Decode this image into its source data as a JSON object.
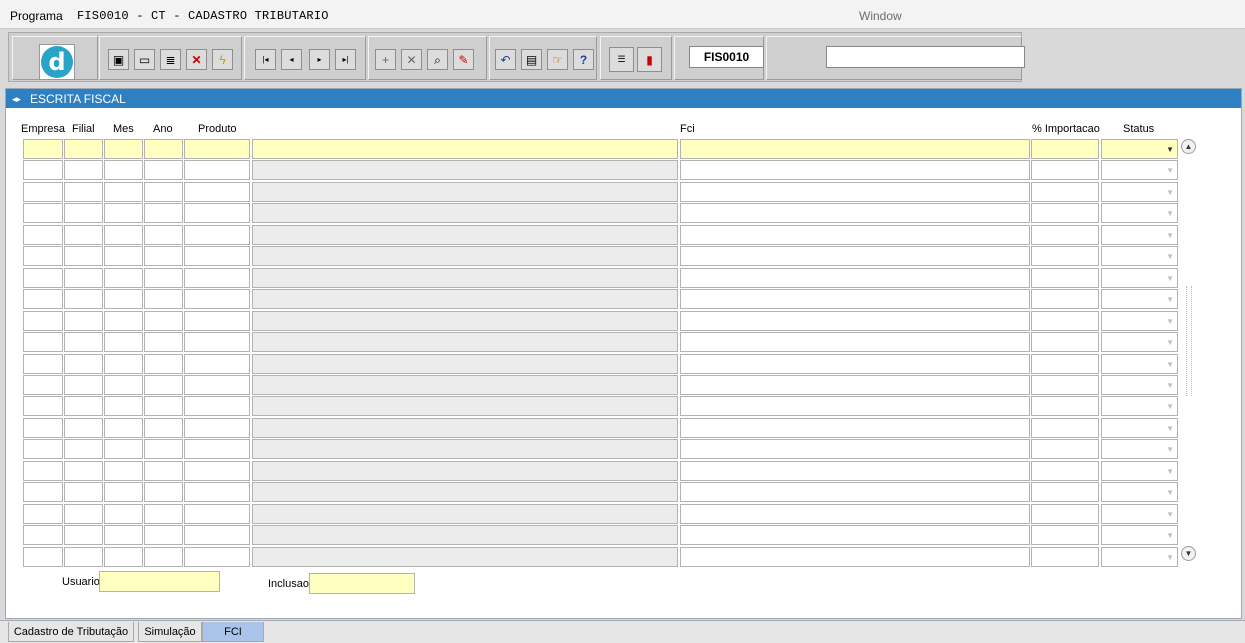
{
  "menubar": {
    "programa": "Programa",
    "title": "FIS0010 - CT - CADASTRO TRIBUTARIO",
    "window": "Window"
  },
  "toolbar": {
    "logo_letter": "d",
    "program_code": "FIS0010",
    "search_value": ""
  },
  "panel": {
    "title": "ESCRITA FISCAL"
  },
  "columns": {
    "empresa": "Empresa",
    "filial": "Filial",
    "mes": "Mes",
    "ano": "Ano",
    "produto": "Produto",
    "fci": "Fci",
    "importacao": "% Importacao",
    "status": "Status"
  },
  "rows": [
    {
      "empresa": "",
      "filial": "",
      "mes": "",
      "ano": "",
      "produto": "",
      "descricao": "",
      "fci": "",
      "importacao": "",
      "status": ""
    },
    {
      "empresa": "",
      "filial": "",
      "mes": "",
      "ano": "",
      "produto": "",
      "descricao": "",
      "fci": "",
      "importacao": "",
      "status": ""
    },
    {
      "empresa": "",
      "filial": "",
      "mes": "",
      "ano": "",
      "produto": "",
      "descricao": "",
      "fci": "",
      "importacao": "",
      "status": ""
    },
    {
      "empresa": "",
      "filial": "",
      "mes": "",
      "ano": "",
      "produto": "",
      "descricao": "",
      "fci": "",
      "importacao": "",
      "status": ""
    },
    {
      "empresa": "",
      "filial": "",
      "mes": "",
      "ano": "",
      "produto": "",
      "descricao": "",
      "fci": "",
      "importacao": "",
      "status": ""
    },
    {
      "empresa": "",
      "filial": "",
      "mes": "",
      "ano": "",
      "produto": "",
      "descricao": "",
      "fci": "",
      "importacao": "",
      "status": ""
    },
    {
      "empresa": "",
      "filial": "",
      "mes": "",
      "ano": "",
      "produto": "",
      "descricao": "",
      "fci": "",
      "importacao": "",
      "status": ""
    },
    {
      "empresa": "",
      "filial": "",
      "mes": "",
      "ano": "",
      "produto": "",
      "descricao": "",
      "fci": "",
      "importacao": "",
      "status": ""
    },
    {
      "empresa": "",
      "filial": "",
      "mes": "",
      "ano": "",
      "produto": "",
      "descricao": "",
      "fci": "",
      "importacao": "",
      "status": ""
    },
    {
      "empresa": "",
      "filial": "",
      "mes": "",
      "ano": "",
      "produto": "",
      "descricao": "",
      "fci": "",
      "importacao": "",
      "status": ""
    },
    {
      "empresa": "",
      "filial": "",
      "mes": "",
      "ano": "",
      "produto": "",
      "descricao": "",
      "fci": "",
      "importacao": "",
      "status": ""
    },
    {
      "empresa": "",
      "filial": "",
      "mes": "",
      "ano": "",
      "produto": "",
      "descricao": "",
      "fci": "",
      "importacao": "",
      "status": ""
    },
    {
      "empresa": "",
      "filial": "",
      "mes": "",
      "ano": "",
      "produto": "",
      "descricao": "",
      "fci": "",
      "importacao": "",
      "status": ""
    },
    {
      "empresa": "",
      "filial": "",
      "mes": "",
      "ano": "",
      "produto": "",
      "descricao": "",
      "fci": "",
      "importacao": "",
      "status": ""
    },
    {
      "empresa": "",
      "filial": "",
      "mes": "",
      "ano": "",
      "produto": "",
      "descricao": "",
      "fci": "",
      "importacao": "",
      "status": ""
    },
    {
      "empresa": "",
      "filial": "",
      "mes": "",
      "ano": "",
      "produto": "",
      "descricao": "",
      "fci": "",
      "importacao": "",
      "status": ""
    },
    {
      "empresa": "",
      "filial": "",
      "mes": "",
      "ano": "",
      "produto": "",
      "descricao": "",
      "fci": "",
      "importacao": "",
      "status": ""
    },
    {
      "empresa": "",
      "filial": "",
      "mes": "",
      "ano": "",
      "produto": "",
      "descricao": "",
      "fci": "",
      "importacao": "",
      "status": ""
    },
    {
      "empresa": "",
      "filial": "",
      "mes": "",
      "ano": "",
      "produto": "",
      "descricao": "",
      "fci": "",
      "importacao": "",
      "status": ""
    },
    {
      "empresa": "",
      "filial": "",
      "mes": "",
      "ano": "",
      "produto": "",
      "descricao": "",
      "fci": "",
      "importacao": "",
      "status": ""
    }
  ],
  "footer": {
    "usuario_label": "Usuario",
    "usuario_value": "",
    "inclusao_label": "Inclusao",
    "inclusao_value": ""
  },
  "tabs": [
    {
      "label": "Cadastro de Tributação",
      "active": false
    },
    {
      "label": "Simulação",
      "active": false
    },
    {
      "label": "FCI",
      "active": true
    }
  ],
  "colors": {
    "header_blue": "#2e80c2",
    "required_yellow": "#ffffc0",
    "active_tab": "#a9c4e8"
  },
  "icons": {
    "save": "save-icon",
    "window": "window-icon",
    "print": "print-icon",
    "cancel": "cancel-record-icon",
    "flash": "flash-icon",
    "first": "first-record-icon",
    "prev": "previous-record-icon",
    "next": "next-record-icon",
    "last": "last-record-icon",
    "insert": "insert-record-icon",
    "delete": "delete-record-icon",
    "query": "query-icon",
    "edit": "edit-icon",
    "undo": "undo-icon",
    "clipboard": "clipboard-icon",
    "help_hand": "help-hand-icon",
    "help": "help-icon",
    "menu": "menu-icon",
    "exit": "exit-icon"
  }
}
